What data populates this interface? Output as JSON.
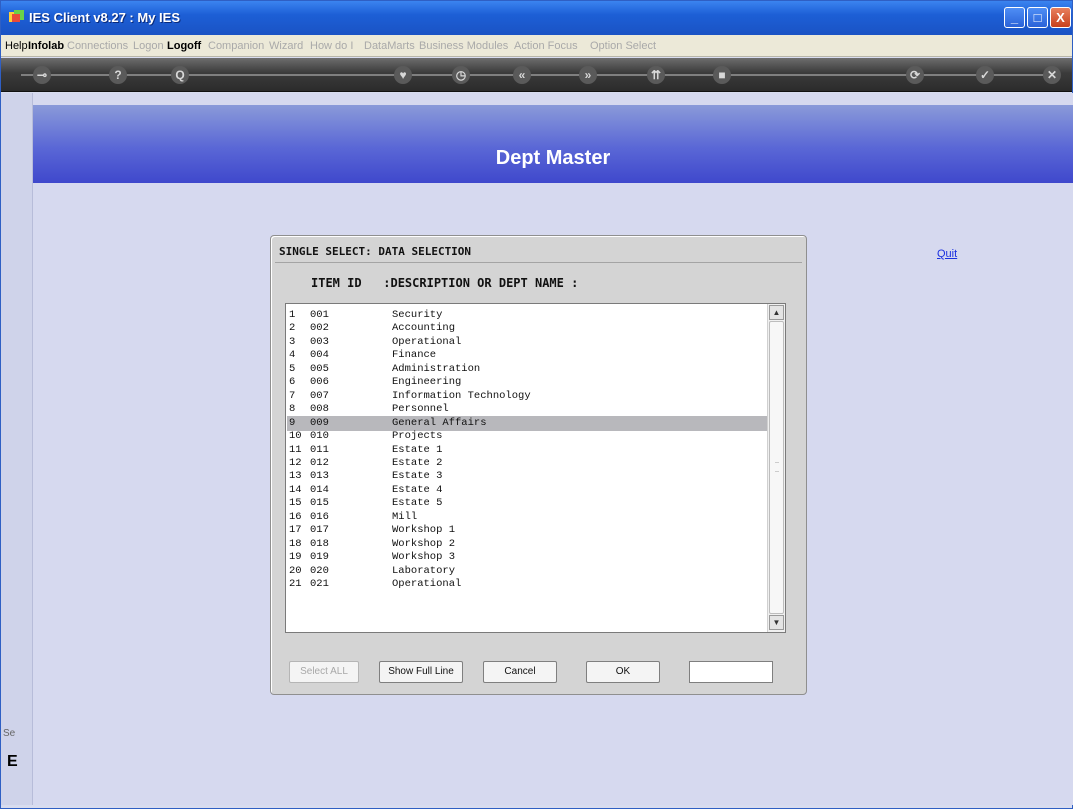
{
  "window": {
    "title": "IES Client v8.27 : My IES",
    "controls": [
      "_",
      "□",
      "X"
    ]
  },
  "menu": [
    {
      "label": "Help",
      "state": "on"
    },
    {
      "label": "Infolab",
      "state": "on"
    },
    {
      "label": "Connections",
      "state": "off"
    },
    {
      "label": "Logon",
      "state": "off"
    },
    {
      "label": "Logoff",
      "state": "bold"
    },
    {
      "label": "Companion",
      "state": "off"
    },
    {
      "label": "Wizard",
      "state": "off"
    },
    {
      "label": "How do I",
      "state": "off"
    },
    {
      "label": "DataMarts",
      "state": "off"
    },
    {
      "label": "Business Modules",
      "state": "off"
    },
    {
      "label": "Action Focus",
      "state": "off"
    },
    {
      "label": "Option Select",
      "state": "off"
    }
  ],
  "toolbar": {
    "icons": [
      "key-icon",
      "help-icon",
      "search-icon",
      "heart-icon",
      "clock-icon",
      "rewind-icon",
      "forward-icon",
      "export-icon",
      "stop-icon",
      "refresh-icon",
      "check-icon",
      "close-icon"
    ],
    "glyphs": [
      "⊸",
      "?",
      "Q",
      "♥",
      "◷",
      "«",
      "»",
      "⇈",
      "■",
      "⟳",
      "✓",
      "✕"
    ]
  },
  "page": {
    "title": "Dept Master",
    "quit_label": "Quit",
    "side_label": "Se",
    "side_glyph": "E"
  },
  "dialog": {
    "title": "SINGLE SELECT: DATA SELECTION",
    "column_header": "ITEM ID   :DESCRIPTION OR DEPT NAME :",
    "selected_index": 8,
    "rows": [
      {
        "num": "1",
        "id": "001",
        "desc": "Security"
      },
      {
        "num": "2",
        "id": "002",
        "desc": "Accounting"
      },
      {
        "num": "3",
        "id": "003",
        "desc": "Operational"
      },
      {
        "num": "4",
        "id": "004",
        "desc": "Finance"
      },
      {
        "num": "5",
        "id": "005",
        "desc": "Administration"
      },
      {
        "num": "6",
        "id": "006",
        "desc": "Engineering"
      },
      {
        "num": "7",
        "id": "007",
        "desc": "Information Technology"
      },
      {
        "num": "8",
        "id": "008",
        "desc": "Personnel"
      },
      {
        "num": "9",
        "id": "009",
        "desc": "General Affairs"
      },
      {
        "num": "10",
        "id": "010",
        "desc": "Projects"
      },
      {
        "num": "11",
        "id": "011",
        "desc": "Estate 1"
      },
      {
        "num": "12",
        "id": "012",
        "desc": "Estate 2"
      },
      {
        "num": "13",
        "id": "013",
        "desc": "Estate 3"
      },
      {
        "num": "14",
        "id": "014",
        "desc": "Estate 4"
      },
      {
        "num": "15",
        "id": "015",
        "desc": "Estate 5"
      },
      {
        "num": "16",
        "id": "016",
        "desc": "Mill"
      },
      {
        "num": "17",
        "id": "017",
        "desc": "Workshop 1"
      },
      {
        "num": "18",
        "id": "018",
        "desc": "Workshop 2"
      },
      {
        "num": "19",
        "id": "019",
        "desc": "Workshop 3"
      },
      {
        "num": "20",
        "id": "020",
        "desc": "Laboratory"
      },
      {
        "num": "21",
        "id": "021",
        "desc": "Operational"
      }
    ],
    "buttons": {
      "select_all": "Select ALL",
      "show_full_line": "Show Full Line",
      "cancel": "Cancel",
      "ok": "OK"
    },
    "input_value": ""
  }
}
